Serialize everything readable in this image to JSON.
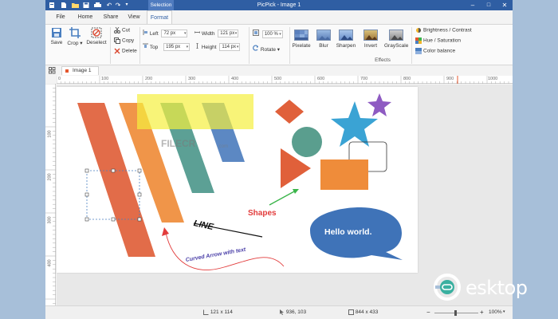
{
  "window": {
    "title": "PicPick - Image 1",
    "selection_tab": "Selection",
    "controls": {
      "minimize": "–",
      "maximize": "□",
      "close": "✕"
    }
  },
  "ribbon_tabs": [
    "File",
    "Home",
    "Share",
    "View",
    "Format"
  ],
  "active_tab": "Format",
  "ribbon": {
    "save": "Save",
    "crop": "Crop",
    "deselect": "Deselect",
    "cut": "Cut",
    "copy": "Copy",
    "delete": "Delete",
    "left_label": "Left",
    "left_value": "72 px",
    "top_label": "Top",
    "top_value": "195 px",
    "width_label": "Width",
    "width_value": "121 px",
    "height_label": "Height",
    "height_value": "114 px",
    "zoom_value": "100 %",
    "rotate": "Rotate",
    "effects": [
      "Pixelate",
      "Blur",
      "Sharpen",
      "Invert",
      "GrayScale"
    ],
    "effects_group_label": "Effects",
    "brightness_contrast": "Brightness / Contrast",
    "hue_saturation": "Hue / Saturation",
    "color_balance": "Color balance"
  },
  "document_tab": "Image 1",
  "ruler": {
    "h_labels": [
      "0",
      "100",
      "200",
      "300",
      "400",
      "500",
      "600",
      "700",
      "800",
      "900",
      "1000"
    ],
    "v_labels": [
      "100",
      "200",
      "300",
      "400"
    ]
  },
  "canvas": {
    "watermark": "FILECR",
    "watermark_sub": ".com",
    "shapes_label": "Shapes",
    "line_label": "LINE",
    "callout_text": "Hello world.",
    "curved_arrow_label": "Curved Arrow with text"
  },
  "status": {
    "selection_size": "121 x 114",
    "cursor_pos": "936, 103",
    "image_size": "844 x 433",
    "zoom": "100%"
  },
  "site_watermark": "esktop",
  "colors": {
    "titlebar": "#2f5ea3",
    "orange_stripe": "#e0603a",
    "highlight": "#f5ef3e",
    "shape_blue": "#4a7fc0",
    "star_blue": "#3aa3d4",
    "purple_star": "#8e5bc2",
    "red_label": "#e23c3c",
    "green_arrow": "#3ab54a"
  }
}
